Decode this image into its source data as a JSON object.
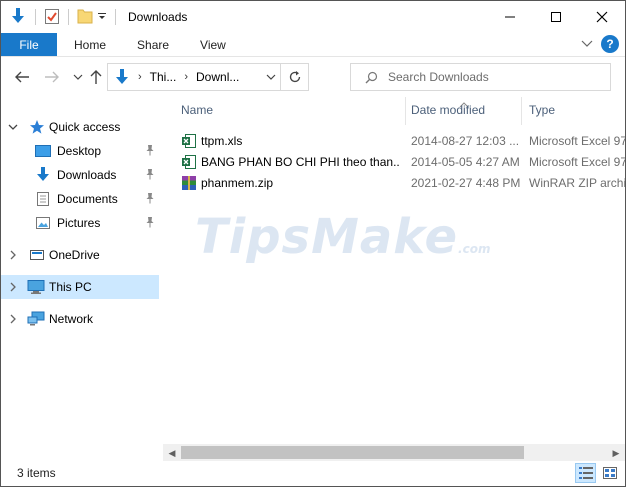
{
  "window": {
    "title": "Downloads"
  },
  "ribbon": {
    "file": "File",
    "tabs": [
      "Home",
      "Share",
      "View"
    ],
    "help": "?"
  },
  "address": {
    "crumbs": [
      "Thi...",
      "Downl..."
    ],
    "search_placeholder": "Search Downloads"
  },
  "navpane": {
    "quick_access": "Quick access",
    "pinned": [
      "Desktop",
      "Downloads",
      "Documents",
      "Pictures"
    ],
    "onedrive": "OneDrive",
    "this_pc": "This PC",
    "network": "Network"
  },
  "columns": {
    "name": "Name",
    "date": "Date modified",
    "type": "Type"
  },
  "files": [
    {
      "name": "ttpm.xls",
      "date": "2014-08-27 12:03 ...",
      "type": "Microsoft Excel 97",
      "icon": "excel-file-icon"
    },
    {
      "name": "BANG PHAN BO CHI PHI theo than...",
      "date": "2014-05-05 4:27 AM",
      "type": "Microsoft Excel 97",
      "icon": "excel-file-icon"
    },
    {
      "name": "phanmem.zip",
      "date": "2021-02-27 4:48 PM",
      "type": "WinRAR ZIP archiv",
      "icon": "winrar-archive-icon"
    }
  ],
  "watermark": {
    "main": "TipsMake",
    "suffix": ".com"
  },
  "status": {
    "count": "3 items"
  },
  "colors": {
    "accent": "#1979ca",
    "selected": "#cce8ff",
    "folder": "#f8d775",
    "excel": "#1e7145"
  }
}
